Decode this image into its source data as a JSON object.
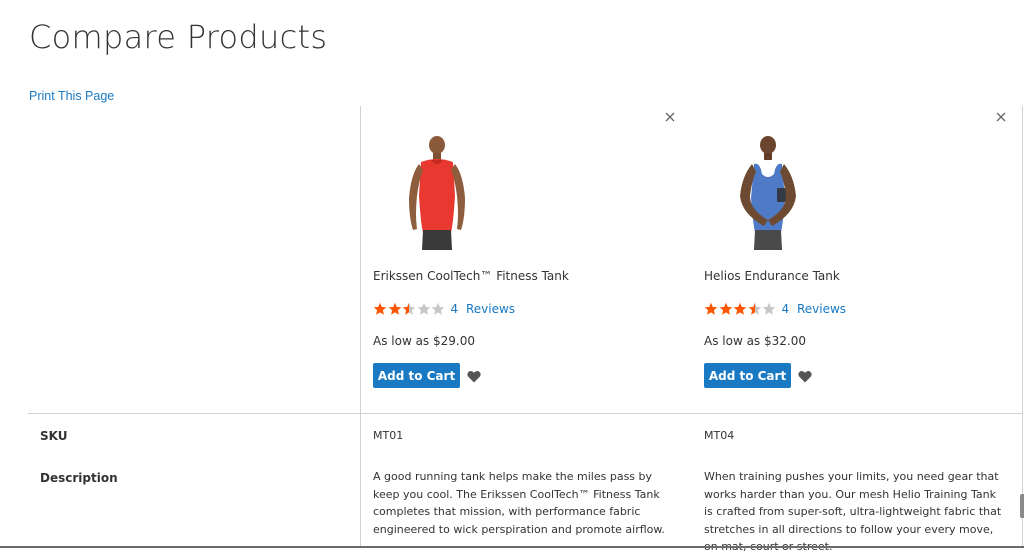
{
  "page": {
    "title": "Compare Products",
    "print_label": "Print This Page"
  },
  "colors": {
    "link": "#1979c3",
    "button": "#1979c3",
    "star_on": "#ff5501",
    "star_off": "#c7c7c7",
    "border": "#d1d1d1"
  },
  "products": [
    {
      "name": "Erikssen CoolTech™ Fitness Tank",
      "rating_stars": 2.5,
      "reviews_count": "4",
      "reviews_label": "Reviews",
      "price": "As low as $29.00",
      "add_to_cart": "Add to Cart",
      "remove_icon": "close-icon",
      "wishlist_icon": "heart-icon",
      "photo_color": "#e8382f",
      "sku": "MT01",
      "description": "A good running tank helps make the miles pass by keep you cool. The Erikssen CoolTech™ Fitness Tank completes that mission, with performance fabric engineered to wick perspiration and promote airflow."
    },
    {
      "name": "Helios Endurance Tank",
      "rating_stars": 3.5,
      "reviews_count": "4",
      "reviews_label": "Reviews",
      "price": "As low as $32.00",
      "add_to_cart": "Add to Cart",
      "remove_icon": "close-icon",
      "wishlist_icon": "heart-icon",
      "photo_color": "#4f7bc6",
      "sku": "MT04",
      "description": "When training pushes your limits, you need gear that works harder than you. Our mesh Helio Training Tank is crafted from super-soft, ultra-lightweight fabric that stretches in all directions to follow your every move, on mat, court or street."
    }
  ],
  "attributes": {
    "sku_label": "SKU",
    "description_label": "Description"
  }
}
